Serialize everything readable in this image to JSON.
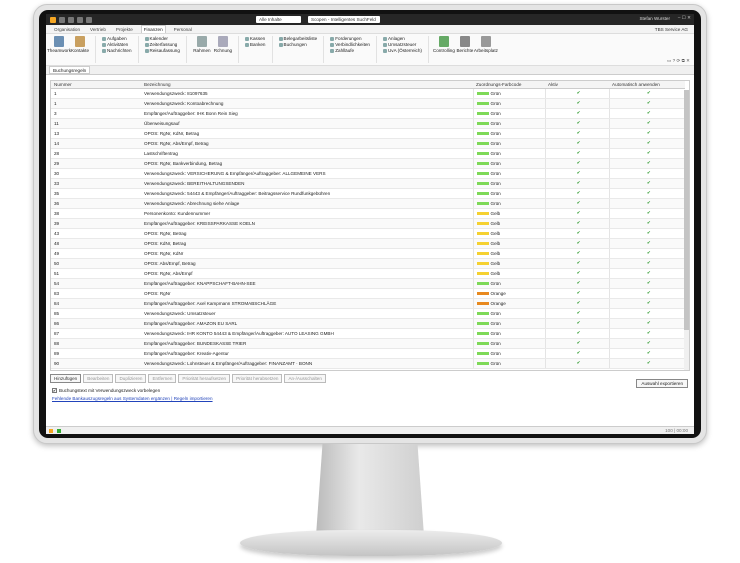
{
  "titlebar": {
    "search": "Alle Inhalte",
    "title": "Scopen - Intelligentes SuchFeld",
    "user": "Stefan Wurster",
    "controls": "– ☐ ✕"
  },
  "menu": {
    "tabs": [
      "Organisation",
      "Vertrieb",
      "Projekte",
      "Finanzen",
      "Personal"
    ],
    "active": 3,
    "company": "TBS Service AG"
  },
  "ribbon": {
    "big": [
      {
        "label": "Theamwork"
      },
      {
        "label": "Kontakte"
      },
      {
        "label": "Rahmen"
      },
      {
        "label": "Rchnung"
      },
      {
        "label": "Controlling"
      },
      {
        "label": "Berichte"
      },
      {
        "label": "Arbeitsplatz"
      }
    ],
    "g1": [
      "Aufgaben",
      "Aktivitäten",
      "Nachrichten"
    ],
    "g2": [
      "Kalender",
      "Zeiterfassung",
      "Reisaufassung"
    ],
    "g3": [
      "Kassen",
      "Banken"
    ],
    "g4": [
      "Belegarbeitsliste",
      "Buchungen"
    ],
    "g5": [
      "Forderungen",
      "Verbindlichkeiten",
      "Zahlläufe"
    ],
    "g6": [
      "Anlagen",
      "Umsatzsteuer",
      "UvA (Österreich)"
    ]
  },
  "tools": "▭ ? ⟳ ⧉ ✕",
  "doctab": "Buchungsregeln",
  "table": {
    "headers": {
      "num": "Nummer",
      "desc": "Bezeichnung",
      "farbe": "Zuordnungs-Farbcode",
      "aktiv": "Aktiv",
      "auto": "Automatisch anwenden"
    },
    "rows": [
      [
        "1",
        "Verwendungszweck: 81097635",
        "Grün"
      ],
      [
        "1",
        "Verwendungszweck: Kontoabrechnung",
        "Grün"
      ],
      [
        "3",
        "Empfänger/Auftraggeber: IHK Bonn Rein Sieg",
        "Grün"
      ],
      [
        "11",
        "Überweisungsauf",
        "Grün"
      ],
      [
        "13",
        "OPOS: RgNr, KdNr, Betrag",
        "Grün"
      ],
      [
        "14",
        "OPOS: RgNr, Abs/Empf, Betrag",
        "Grün"
      ],
      [
        "28",
        "Lastschriftentrag",
        "Grün"
      ],
      [
        "29",
        "OPOS: RgNr, Bankverbindung, Betrag",
        "Grün"
      ],
      [
        "30",
        "Verwendungszweck: VERSICHERUNG & Empfänger/Auftraggeber: ALLGEMEINE VERS",
        "Grün"
      ],
      [
        "33",
        "Verwendungszweck: BEREITHALTUNGSENDEN",
        "Grün"
      ],
      [
        "35",
        "Verwendungszweck: 54443 & Empfänger/Auftraggeber: Beitragsservice Rundfunkgebühren",
        "Grün"
      ],
      [
        "36",
        "Verwendungszweck: Abrechnung siehe Anlage",
        "Grün"
      ],
      [
        "38",
        "Personenkonto: Kundennummer",
        "Gelb"
      ],
      [
        "39",
        "Empfänger/Auftraggeber: KREISSPARKASSE KOELN",
        "Gelb"
      ],
      [
        "43",
        "OPOS: RgNr, Betrag",
        "Gelb"
      ],
      [
        "48",
        "OPOS: KdNr, Betrag",
        "Gelb"
      ],
      [
        "49",
        "OPOS: RgNr, KdNr",
        "Gelb"
      ],
      [
        "50",
        "OPOS: Abs/Empf, Betrag",
        "Gelb"
      ],
      [
        "51",
        "OPOS: RgNr, Abs/Empf",
        "Gelb"
      ],
      [
        "54",
        "Empfänger/Auftraggeber: KNAPPSCHAFT-BAHN-SEE",
        "Grün"
      ],
      [
        "83",
        "OPOS: RgNr",
        "Orange"
      ],
      [
        "84",
        "Empfänger/Auftraggeber: Axel Kampmann STROMABSCHLÄGE",
        "Orange"
      ],
      [
        "85",
        "Verwendungszweck: Umsatzsteuer",
        "Grün"
      ],
      [
        "86",
        "Empfänger/Auftraggeber: AMAZON EU SARL",
        "Grün"
      ],
      [
        "87",
        "Verwendungszweck: IHR KONTO 54443 & Empfänger/Auftraggeber: AUTO LEASING GMBH",
        "Grün"
      ],
      [
        "88",
        "Empfänger/Auftraggeber: BUNDESKASSE TRIER",
        "Grün"
      ],
      [
        "89",
        "Empfänger/Auftraggeber: Kreativ-Agentur",
        "Grün"
      ],
      [
        "90",
        "Verwendungszweck: Lohnsteuer & Empfänger/Auftraggeber: FINANZAMT · BONN",
        "Grün"
      ]
    ]
  },
  "colors": {
    "Grün": "#7ed957",
    "Gelb": "#f5d130",
    "Orange": "#e8891f"
  },
  "check": "✔",
  "actions": [
    "Hinzufügen",
    "Bearbeiten",
    "Duplizieren",
    "Entfernen",
    "Priorität heraufsetzen",
    "Priorität herabsetzen",
    "An-/Ausschalten"
  ],
  "export_label": "Auswahl exportieren",
  "checkbox_label": "Buchungstext mit Verwendungszweck vorbelegen",
  "links": "Fehlende Bankauszugsregeln aus Systemdaten ergänzen | Regeln importieren",
  "status_zoom": "100 | 00:00"
}
